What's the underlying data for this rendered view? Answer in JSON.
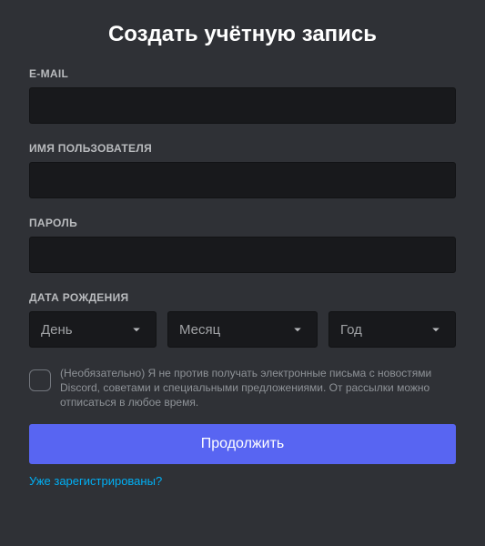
{
  "title": "Создать учётную запись",
  "fields": {
    "email_label": "E-MAIL",
    "username_label": "ИМЯ ПОЛЬЗОВАТЕЛЯ",
    "password_label": "ПАРОЛЬ",
    "dob_label": "ДАТА РОЖДЕНИЯ"
  },
  "dob": {
    "day": "День",
    "month": "Месяц",
    "year": "Год"
  },
  "optin_text": "(Необязательно) Я не против получать электронные письма с новостями Discord, советами и специальными предложениями. От рассылки можно отписаться в любое время.",
  "continue_label": "Продолжить",
  "already_registered": "Уже зарегистрированы?"
}
